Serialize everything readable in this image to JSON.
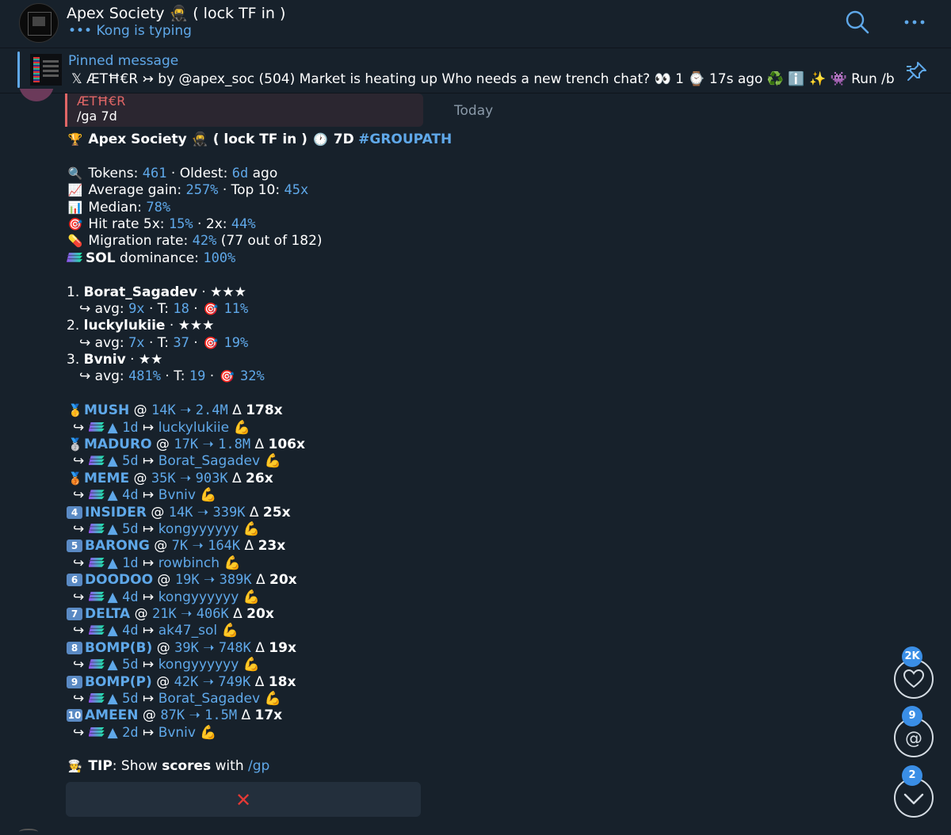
{
  "header": {
    "title": "Apex Society 🥷 ( lock TF in )",
    "status_dots": "•••",
    "status": "Kong is typing"
  },
  "pinned": {
    "label": "Pinned message",
    "text": "𝕏 ÆTĦ€R ↣ by @apex_soc (504) Market is heating up  Who needs a new trench chat? 👀 1 ⌚ 17s ago ♻️ ℹ️ ✨ 👾 Run /b"
  },
  "date_separator": "Today",
  "reply": {
    "name": "ÆTĦ€R",
    "text": "/ga 7d"
  },
  "message": {
    "title_prefix": "🏆",
    "title": "Apex Society 🥷 ( lock TF in )",
    "title_clock": "🕐",
    "title_period": "7D",
    "title_tag": "#GROUPATH",
    "stats": {
      "tokens_label": "Tokens:",
      "tokens": "461",
      "oldest_label": "Oldest:",
      "oldest": "6d",
      "oldest_suffix": "ago",
      "avg_gain_label": "Average gain:",
      "avg_gain": "257%",
      "top10_label": "Top 10:",
      "top10": "45x",
      "median_label": "Median:",
      "median": "78%",
      "hit5_label": "Hit rate 5x:",
      "hit5": "15%",
      "hit2_label": "2x:",
      "hit2": "44%",
      "migration_label": "Migration rate:",
      "migration": "42%",
      "migration_detail": "(77 out of 182)",
      "sol_label": "SOL",
      "sol_dom_label": "dominance:",
      "sol_dom": "100%"
    },
    "ranking": [
      {
        "rank": "1.",
        "name": "Borat_Sagadev",
        "stars": "★★★",
        "avg": "9x",
        "t": "18",
        "hit": "11%"
      },
      {
        "rank": "2.",
        "name": "luckylukiie",
        "stars": "★★★",
        "avg": "7x",
        "t": "37",
        "hit": "19%"
      },
      {
        "rank": "3.",
        "name": "Bvniv",
        "stars": "★★",
        "avg": "481%",
        "t": "19",
        "hit": "32%"
      }
    ],
    "ranking_labels": {
      "avg": "avg:",
      "t": "T:"
    },
    "tokens": [
      {
        "badge": "🥇",
        "name": "MUSH",
        "from": "14K",
        "to": "2.4M",
        "mult": "178x",
        "age": "1d",
        "caller": "luckylukiie"
      },
      {
        "badge": "🥈",
        "name": "MADURO",
        "from": "17K",
        "to": "1.8M",
        "mult": "106x",
        "age": "5d",
        "caller": "Borat_Sagadev"
      },
      {
        "badge": "🥉",
        "name": "MEME",
        "from": "35K",
        "to": "903K",
        "mult": "26x",
        "age": "4d",
        "caller": "Bvniv"
      },
      {
        "badge": "4",
        "name": "INSIDER",
        "from": "14K",
        "to": "339K",
        "mult": "25x",
        "age": "5d",
        "caller": "kongyyyyyy"
      },
      {
        "badge": "5",
        "name": "BARONG",
        "from": "7K",
        "to": "164K",
        "mult": "23x",
        "age": "1d",
        "caller": "rowbinch"
      },
      {
        "badge": "6",
        "name": "DOODOO",
        "from": "19K",
        "to": "389K",
        "mult": "20x",
        "age": "4d",
        "caller": "kongyyyyyy"
      },
      {
        "badge": "7",
        "name": "DELTA",
        "from": "21K",
        "to": "406K",
        "mult": "20x",
        "age": "4d",
        "caller": "ak47_sol"
      },
      {
        "badge": "8",
        "name": "BOMP(B)",
        "from": "39K",
        "to": "748K",
        "mult": "19x",
        "age": "5d",
        "caller": "kongyyyyyy"
      },
      {
        "badge": "9",
        "name": "BOMP(P)",
        "from": "42K",
        "to": "749K",
        "mult": "18x",
        "age": "5d",
        "caller": "Borat_Sagadev"
      },
      {
        "badge": "10",
        "name": "AMEEN",
        "from": "87K",
        "to": "1.5M",
        "mult": "17x",
        "age": "2d",
        "caller": "Bvniv"
      }
    ],
    "tip": {
      "label": "TIP",
      "text": ": Show ",
      "bold": "scores",
      "mid": " with ",
      "cmd": "/gp"
    },
    "close_button": "✕"
  },
  "fabs": {
    "reactions_badge": "2K",
    "mentions_badge": "9",
    "scroll_badge": "2"
  },
  "colors": {
    "background": "#17212b",
    "accent": "#5fa8e9",
    "reply_name": "#e06666",
    "badge": "#3a8ee6"
  }
}
